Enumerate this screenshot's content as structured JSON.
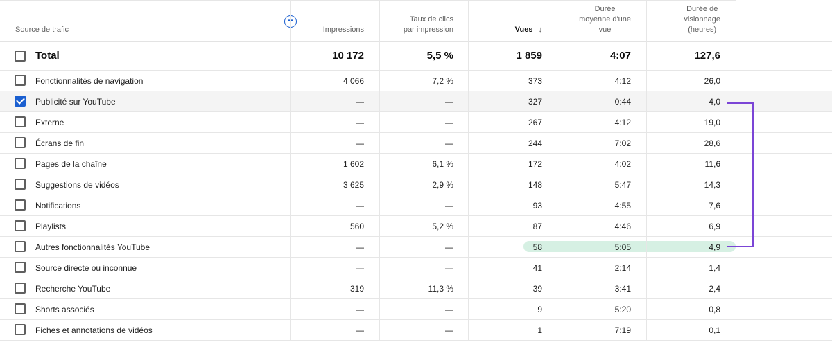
{
  "header": {
    "source": "Source de trafic",
    "impressions": "Impressions",
    "ctr": [
      "Taux de clics",
      "par impression"
    ],
    "views": "Vues",
    "avg_duration": [
      "Durée",
      "moyenne d'une",
      "vue"
    ],
    "watch_time": [
      "Durée de",
      "visionnage",
      "(heures)"
    ],
    "add_icon": "plus-circle-icon",
    "sort_icon": "arrow-down-icon"
  },
  "total": {
    "label": "Total",
    "impressions": "10 172",
    "ctr": "5,5 %",
    "views": "1 859",
    "avg_duration": "4:07",
    "watch_time": "127,6"
  },
  "rows": [
    {
      "source": "Fonctionnalités de navigation",
      "impressions": "4 066",
      "ctr": "7,2 %",
      "views": "373",
      "avg_duration": "4:12",
      "watch_time": "26,0",
      "checked": false
    },
    {
      "source": "Publicité sur YouTube",
      "impressions": "—",
      "ctr": "—",
      "views": "327",
      "avg_duration": "0:44",
      "watch_time": "4,0",
      "checked": true
    },
    {
      "source": "Externe",
      "impressions": "—",
      "ctr": "—",
      "views": "267",
      "avg_duration": "4:12",
      "watch_time": "19,0",
      "checked": false
    },
    {
      "source": "Écrans de fin",
      "impressions": "—",
      "ctr": "—",
      "views": "244",
      "avg_duration": "7:02",
      "watch_time": "28,6",
      "checked": false
    },
    {
      "source": "Pages de la chaîne",
      "impressions": "1 602",
      "ctr": "6,1 %",
      "views": "172",
      "avg_duration": "4:02",
      "watch_time": "11,6",
      "checked": false
    },
    {
      "source": "Suggestions de vidéos",
      "impressions": "3 625",
      "ctr": "2,9 %",
      "views": "148",
      "avg_duration": "5:47",
      "watch_time": "14,3",
      "checked": false
    },
    {
      "source": "Notifications",
      "impressions": "—",
      "ctr": "—",
      "views": "93",
      "avg_duration": "4:55",
      "watch_time": "7,6",
      "checked": false
    },
    {
      "source": "Playlists",
      "impressions": "560",
      "ctr": "5,2 %",
      "views": "87",
      "avg_duration": "4:46",
      "watch_time": "6,9",
      "checked": false
    },
    {
      "source": "Autres fonctionnalités YouTube",
      "impressions": "—",
      "ctr": "—",
      "views": "58",
      "avg_duration": "5:05",
      "watch_time": "4,9",
      "checked": false
    },
    {
      "source": "Source directe ou inconnue",
      "impressions": "—",
      "ctr": "—",
      "views": "41",
      "avg_duration": "2:14",
      "watch_time": "1,4",
      "checked": false
    },
    {
      "source": "Recherche YouTube",
      "impressions": "319",
      "ctr": "11,3 %",
      "views": "39",
      "avg_duration": "3:41",
      "watch_time": "2,4",
      "checked": false
    },
    {
      "source": "Shorts associés",
      "impressions": "—",
      "ctr": "—",
      "views": "9",
      "avg_duration": "5:20",
      "watch_time": "0,8",
      "checked": false
    },
    {
      "source": "Fiches et annotations de vidéos",
      "impressions": "—",
      "ctr": "—",
      "views": "1",
      "avg_duration": "7:19",
      "watch_time": "0,1",
      "checked": false
    }
  ],
  "annotations": {
    "highlight_blue": "#c6d9f7",
    "highlight_green": "#d6f0e3",
    "bracket_color": "#7b45d6"
  },
  "colors": {
    "accent": "#1a5fd0"
  }
}
